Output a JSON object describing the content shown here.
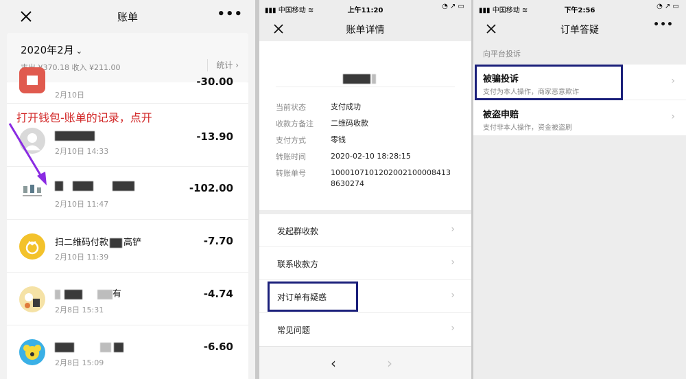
{
  "panel1": {
    "title": "账单",
    "month": "2020年2月",
    "summary": "支出 ¥370.18 收入 ¥211.00",
    "stats_label": "统计",
    "annotation": "打开钱包-账单的记录，点开",
    "bills": [
      {
        "name": "",
        "time": "2月10日",
        "amount": "-30.00",
        "avatar": "red-gift"
      },
      {
        "name": "",
        "time": "2月10日 14:33",
        "amount": "-13.90",
        "avatar": "default-person"
      },
      {
        "name": "",
        "time": "2月10日 11:47",
        "amount": "-102.00",
        "avatar": "store-logo"
      },
      {
        "name": "扫二维码付款",
        "name_suffix": "高铲",
        "time": "2月10日 11:39",
        "amount": "-7.70",
        "avatar": "qr-pay"
      },
      {
        "name": "",
        "name_suffix": "有",
        "time": "2月8日 15:31",
        "amount": "-4.74",
        "avatar": "cartoon"
      },
      {
        "name": "",
        "time": "2月8日 15:09",
        "amount": "-6.60",
        "avatar": "koala"
      }
    ]
  },
  "panel2": {
    "status": {
      "left": "中国移动",
      "time": "上午11:20"
    },
    "title": "账单详情",
    "details": [
      {
        "label": "当前状态",
        "value": "支付成功"
      },
      {
        "label": "收款方备注",
        "value": "二维码收款"
      },
      {
        "label": "支付方式",
        "value": "零钱"
      },
      {
        "label": "转账时间",
        "value": "2020-02-10 18:28:15"
      },
      {
        "label": "转账单号",
        "value": "1000107101202002100008413 8630274"
      }
    ],
    "menu": [
      {
        "label": "发起群收款"
      },
      {
        "label": "联系收款方"
      },
      {
        "label": "对订单有疑惑"
      },
      {
        "label": "常见问题"
      }
    ]
  },
  "panel3": {
    "status": {
      "left": "中国移动",
      "time": "下午2:56"
    },
    "title": "订单答疑",
    "section": "向平台投诉",
    "items": [
      {
        "title": "被骗投诉",
        "subtitle": "支付为本人操作，商家恶意欺诈"
      },
      {
        "title": "被盗申赔",
        "subtitle": "支付非本人操作，资金被盗刷"
      }
    ]
  },
  "colors": {
    "annotation": "#d22727",
    "highlight": "#1a1f7a",
    "arrow": "#8a2be2"
  }
}
